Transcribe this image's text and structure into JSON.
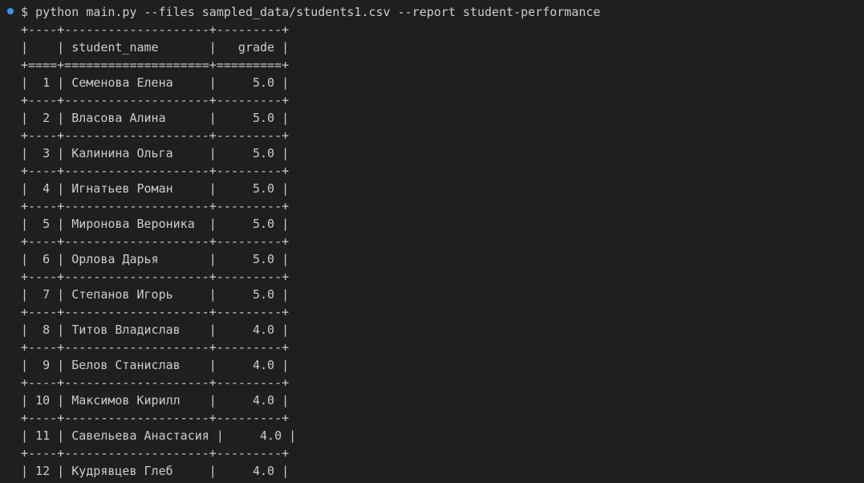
{
  "terminal": {
    "prompt": "$",
    "command": "python main.py --files sampled_data/students1.csv --report student-performance"
  },
  "table": {
    "columns": [
      "",
      "student_name",
      "grade"
    ],
    "rows": [
      {
        "index": "1",
        "student_name": "Семенова Елена",
        "grade": "5.0"
      },
      {
        "index": "2",
        "student_name": "Власова Алина",
        "grade": "5.0"
      },
      {
        "index": "3",
        "student_name": "Калинина Ольга",
        "grade": "5.0"
      },
      {
        "index": "4",
        "student_name": "Игнатьев Роман",
        "grade": "5.0"
      },
      {
        "index": "5",
        "student_name": "Миронова Вероника",
        "grade": "5.0"
      },
      {
        "index": "6",
        "student_name": "Орлова Дарья",
        "grade": "5.0"
      },
      {
        "index": "7",
        "student_name": "Степанов Игорь",
        "grade": "5.0"
      },
      {
        "index": "8",
        "student_name": "Титов Владислав",
        "grade": "4.0"
      },
      {
        "index": "9",
        "student_name": "Белов Станислав",
        "grade": "4.0"
      },
      {
        "index": "10",
        "student_name": "Максимов Кирилл",
        "grade": "4.0"
      },
      {
        "index": "11",
        "student_name": "Савельева Анастасия",
        "grade": "4.0"
      },
      {
        "index": "12",
        "student_name": "Кудрявцев Глеб",
        "grade": "4.0"
      }
    ]
  }
}
